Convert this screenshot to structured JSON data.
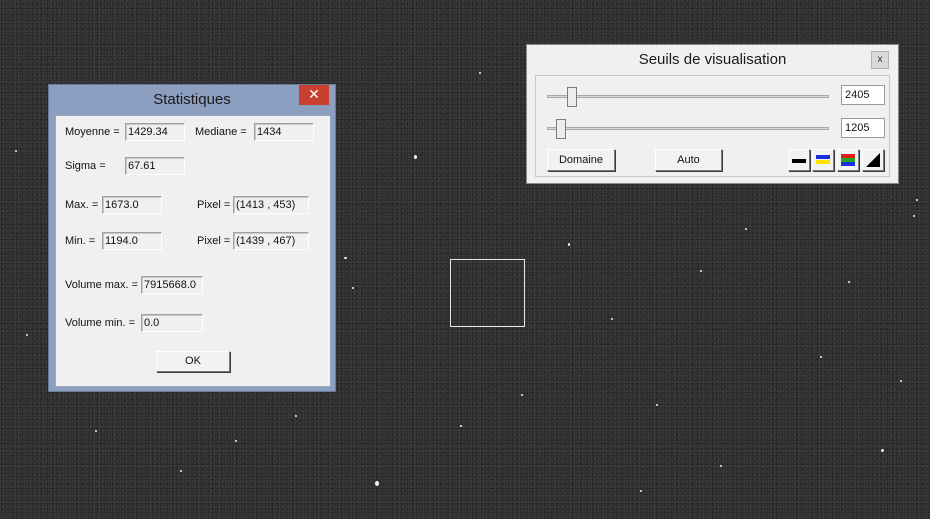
{
  "stats": {
    "title": "Statistiques",
    "close_glyph": "✕",
    "moyenne_label": "Moyenne =",
    "moyenne_value": "1429.34",
    "mediane_label": "Mediane =",
    "mediane_value": "1434",
    "sigma_label": "Sigma =",
    "sigma_value": "67.61",
    "max_label": "Max. =",
    "max_value": "1673.0",
    "pixel_max_label": "Pixel =",
    "pixel_max_value": "(1413 , 453)",
    "min_label": "Min. =",
    "min_value": "1194.0",
    "pixel_min_label": "Pixel =",
    "pixel_min_value": "(1439 , 467)",
    "volume_max_label": "Volume max. =",
    "volume_max_value": "7915668.0",
    "volume_min_label": "Volume min. =",
    "volume_min_value": "0.0",
    "ok_label": "OK"
  },
  "seuils": {
    "title": "Seuils de visualisation",
    "close_glyph": "x",
    "high_value": "2405",
    "low_value": "1205",
    "high_level": 0.09,
    "low_level": 0.05,
    "domaine_label": "Domaine",
    "auto_label": "Auto",
    "palette_icons": [
      "gray-palette-icon",
      "blue-yellow-palette-icon",
      "rainbow-palette-icon",
      "ramp-palette-icon"
    ],
    "colors": {
      "blue": "#1a2fe0",
      "yellow": "#ffe400",
      "red": "#e0201a",
      "green": "#1fa81f"
    }
  }
}
